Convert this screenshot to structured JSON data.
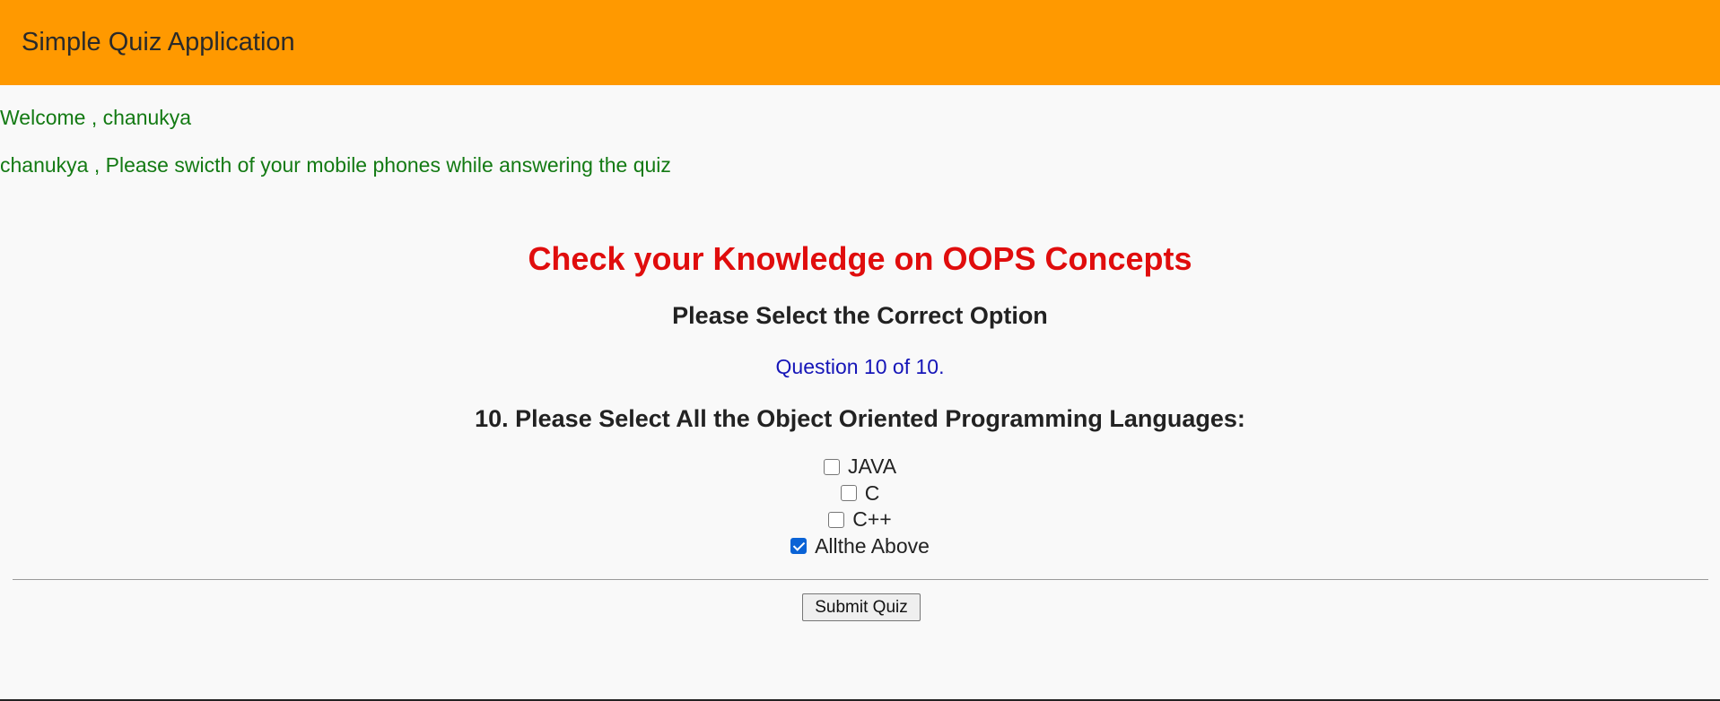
{
  "header": {
    "title": "Simple Quiz Application"
  },
  "user": {
    "welcome": "Welcome , chanukya",
    "notice": "chanukya , Please swicth of your mobile phones while answering the quiz"
  },
  "quiz": {
    "title": "Check your Knowledge on OOPS Concepts",
    "subtitle": "Please Select the Correct Option",
    "progress": "Question 10 of 10.",
    "question": "10. Please Select All the Object Oriented Programming Languages:",
    "options": [
      {
        "label": "JAVA",
        "checked": false
      },
      {
        "label": "C",
        "checked": false
      },
      {
        "label": "C++",
        "checked": false
      },
      {
        "label": "Allthe Above",
        "checked": true
      }
    ],
    "submit_label": "Submit Quiz"
  },
  "colors": {
    "header_bg": "#ff9900",
    "welcome_text": "#137a13",
    "title_text": "#e00d0d",
    "progress_text": "#1515b8",
    "checkbox_checked": "#0a63d6"
  }
}
